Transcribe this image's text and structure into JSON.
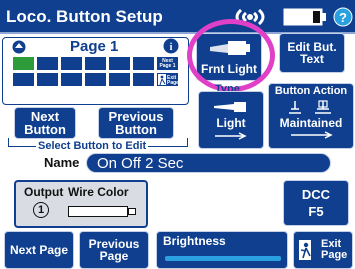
{
  "header": {
    "title": "Loco. Button Setup"
  },
  "page_panel": {
    "page_label": "Page 1",
    "next_page_small": "Next Page 1",
    "exit_page_small": "Exit Page"
  },
  "buttons": {
    "next_button": "Next Button",
    "previous_button": "Previous Button",
    "select_caption": "Select Button to Edit"
  },
  "selected_button": {
    "label": "Frnt Light"
  },
  "edit_button_text": "Edit But. Text",
  "type_section": {
    "title": "Type",
    "value": "Light"
  },
  "action_section": {
    "title": "Button Action",
    "value": "Maintained"
  },
  "name": {
    "label": "Name",
    "value": "On Off 2 Sec"
  },
  "output": {
    "title": "Output",
    "wire_label": "Wire Color",
    "number": "1"
  },
  "dcc": {
    "line1": "DCC",
    "line2": "F5"
  },
  "bottom": {
    "next_page": "Next Page",
    "previous_page": "Previous Page",
    "brightness": "Brightness",
    "exit_page": "Exit Page"
  },
  "colors": {
    "primary": "#0f3f8e",
    "highlight_ring": "#e040c8",
    "help": "#2aa0e0",
    "selected_cell": "#2e9b3a"
  }
}
